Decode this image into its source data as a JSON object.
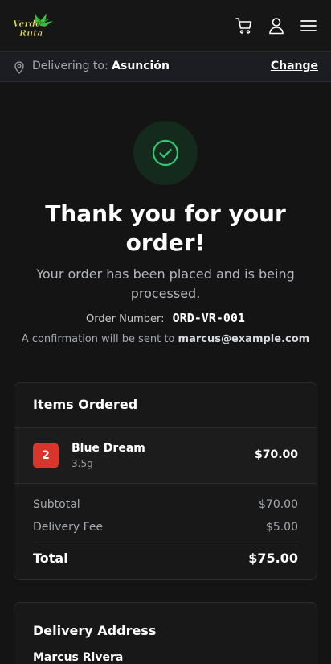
{
  "header": {
    "logo_text": "Verde Ruta",
    "icons": [
      "cart-icon",
      "user-icon",
      "menu-icon"
    ]
  },
  "delivery_bar": {
    "prefix": "Delivering to:",
    "location": "Asunción",
    "change_label": "Change"
  },
  "confirmation": {
    "title": "Thank you for your order!",
    "subtitle": "Your order has been placed and is being processed.",
    "order_number_label": "Order Number:",
    "order_number": "ORD-VR-001",
    "confirm_prefix": "A confirmation will be sent to",
    "email": "marcus@example.com"
  },
  "items_card": {
    "title": "Items Ordered",
    "items": [
      {
        "quantity": "2",
        "name": "Blue Dream",
        "size": "3.5g",
        "price": "$70.00"
      }
    ],
    "subtotal_label": "Subtotal",
    "subtotal": "$70.00",
    "delivery_fee_label": "Delivery Fee",
    "delivery_fee": "$5.00",
    "total_label": "Total",
    "total": "$75.00"
  },
  "address_card": {
    "title": "Delivery Address",
    "name": "Marcus Rivera"
  },
  "colors": {
    "background": "#141414",
    "accent_green": "#2ecc71",
    "badge_red": "#d9352b"
  }
}
